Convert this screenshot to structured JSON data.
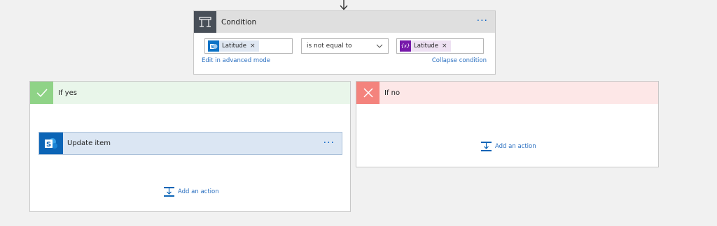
{
  "condition": {
    "title": "Condition",
    "icon": "condition-icon",
    "more": "···",
    "left_operand": {
      "label": "Latitude",
      "remove": "×",
      "icon": "sharepoint-icon"
    },
    "operator": {
      "value": "is not equal to"
    },
    "right_operand": {
      "label": "Latitude",
      "remove": "×",
      "icon": "expression-icon",
      "icon_text": "{x}"
    },
    "edit_link": "Edit in advanced mode",
    "collapse_link": "Collapse condition"
  },
  "if_yes": {
    "title": "If yes",
    "icon": "check-icon",
    "action": {
      "title": "Update item",
      "icon": "sharepoint-icon",
      "more": "···"
    },
    "add_action": "Add an action"
  },
  "if_no": {
    "title": "If no",
    "icon": "x-icon",
    "add_action": "Add an action"
  },
  "colors": {
    "condition_icon_bg": "#484f58",
    "yes_accent": "#8fd387",
    "no_accent": "#f4837d",
    "sharepoint": "#0b64b6",
    "expression": "#7719aa",
    "link": "#2a6fc0"
  }
}
